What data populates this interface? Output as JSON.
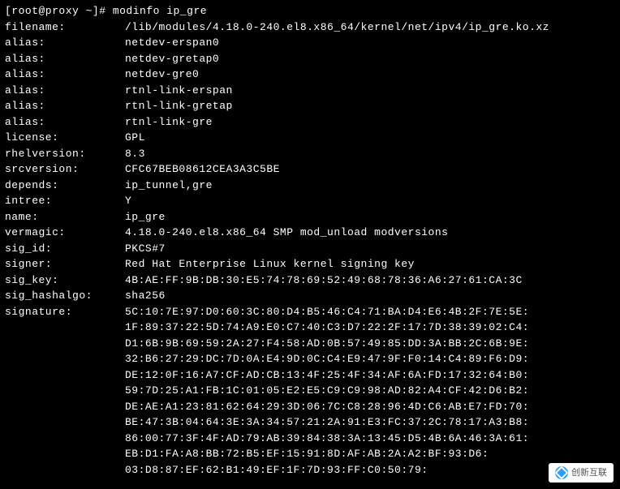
{
  "prompt": "[root@proxy ~]# ",
  "command": "modinfo ip_gre",
  "fields": [
    {
      "label": "filename:",
      "value": "/lib/modules/4.18.0-240.el8.x86_64/kernel/net/ipv4/ip_gre.ko.xz"
    },
    {
      "label": "alias:",
      "value": "netdev-erspan0"
    },
    {
      "label": "alias:",
      "value": "netdev-gretap0"
    },
    {
      "label": "alias:",
      "value": "netdev-gre0"
    },
    {
      "label": "alias:",
      "value": "rtnl-link-erspan"
    },
    {
      "label": "alias:",
      "value": "rtnl-link-gretap"
    },
    {
      "label": "alias:",
      "value": "rtnl-link-gre"
    },
    {
      "label": "license:",
      "value": "GPL"
    },
    {
      "label": "rhelversion:",
      "value": "8.3"
    },
    {
      "label": "srcversion:",
      "value": "CFC67BEB08612CEA3A3C5BE"
    },
    {
      "label": "depends:",
      "value": "ip_tunnel,gre"
    },
    {
      "label": "intree:",
      "value": "Y"
    },
    {
      "label": "name:",
      "value": "ip_gre"
    },
    {
      "label": "vermagic:",
      "value": "4.18.0-240.el8.x86_64 SMP mod_unload modversions"
    },
    {
      "label": "sig_id:",
      "value": "PKCS#7"
    },
    {
      "label": "signer:",
      "value": "Red Hat Enterprise Linux kernel signing key"
    },
    {
      "label": "sig_key:",
      "value": "4B:AE:FF:9B:DB:30:E5:74:78:69:52:49:68:78:36:A6:27:61:CA:3C"
    },
    {
      "label": "sig_hashalgo:",
      "value": "sha256"
    },
    {
      "label": "signature:",
      "value": "5C:10:7E:97:D0:60:3C:80:D4:B5:46:C4:71:BA:D4:E6:4B:2F:7E:5E:"
    },
    {
      "label": "",
      "value": "1F:89:37:22:5D:74:A9:E0:C7:40:C3:D7:22:2F:17:7D:38:39:02:C4:"
    },
    {
      "label": "",
      "value": "D1:6B:9B:69:59:2A:27:F4:58:AD:0B:57:49:85:DD:3A:BB:2C:6B:9E:"
    },
    {
      "label": "",
      "value": "32:B6:27:29:DC:7D:0A:E4:9D:0C:C4:E9:47:9F:F0:14:C4:89:F6:D9:"
    },
    {
      "label": "",
      "value": "DE:12:0F:16:A7:CF:AD:CB:13:4F:25:4F:34:AF:6A:FD:17:32:64:B0:"
    },
    {
      "label": "",
      "value": "59:7D:25:A1:FB:1C:01:05:E2:E5:C9:C9:98:AD:82:A4:CF:42:D6:B2:"
    },
    {
      "label": "",
      "value": "DE:AE:A1:23:81:62:64:29:3D:06:7C:C8:28:96:4D:C6:AB:E7:FD:70:"
    },
    {
      "label": "",
      "value": "BE:47:3B:04:64:3E:3A:34:57:21:2A:91:E3:FC:37:2C:78:17:A3:B8:"
    },
    {
      "label": "",
      "value": "86:00:77:3F:4F:AD:79:AB:39:84:38:3A:13:45:D5:4B:6A:46:3A:61:"
    },
    {
      "label": "",
      "value": "EB:D1:FA:A8:BB:72:B5:EF:15:91:8D:AF:AB:2A:A2:BF:93:D6:"
    },
    {
      "label": "",
      "value": "03:D8:87:EF:62:B1:49:EF:1F:7D:93:FF:C0:50:79:"
    }
  ],
  "watermark": "创新互联"
}
